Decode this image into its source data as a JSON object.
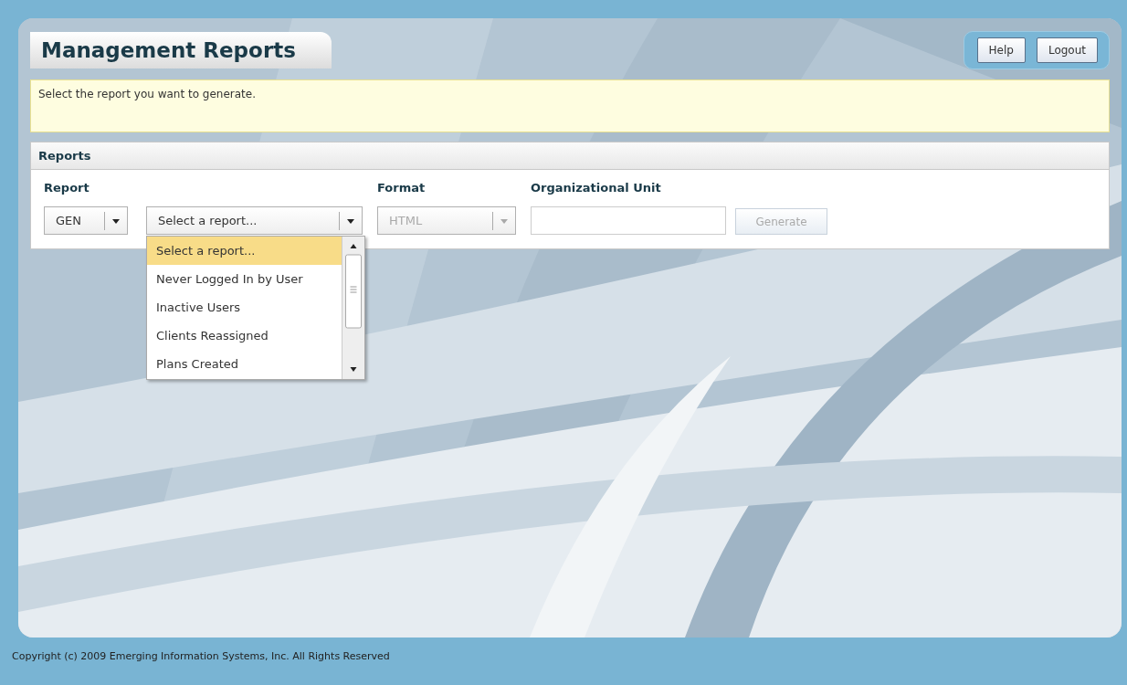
{
  "header": {
    "title": "Management Reports",
    "buttons": [
      {
        "label": "Help"
      },
      {
        "label": "Logout"
      }
    ]
  },
  "message": "Select the report you want to generate.",
  "reports_panel": {
    "title": "Reports",
    "report": {
      "label": "Report",
      "category": {
        "value": "GEN"
      },
      "select": {
        "value": "Select a report...",
        "expanded": true,
        "options": [
          {
            "label": "Select a report...",
            "selected": true
          },
          {
            "label": "Never Logged In by User",
            "selected": false
          },
          {
            "label": "Inactive Users",
            "selected": false
          },
          {
            "label": "Clients Reassigned",
            "selected": false
          },
          {
            "label": "Plans Created",
            "selected": false
          }
        ]
      }
    },
    "format": {
      "label": "Format",
      "value": "HTML",
      "disabled": true
    },
    "organizational_unit": {
      "label": "Organizational Unit"
    },
    "generate_button": {
      "label": "Generate",
      "disabled": true
    }
  },
  "footer": "Copyright (c) 2009 Emerging Information Systems, Inc. All Rights Reserved"
}
